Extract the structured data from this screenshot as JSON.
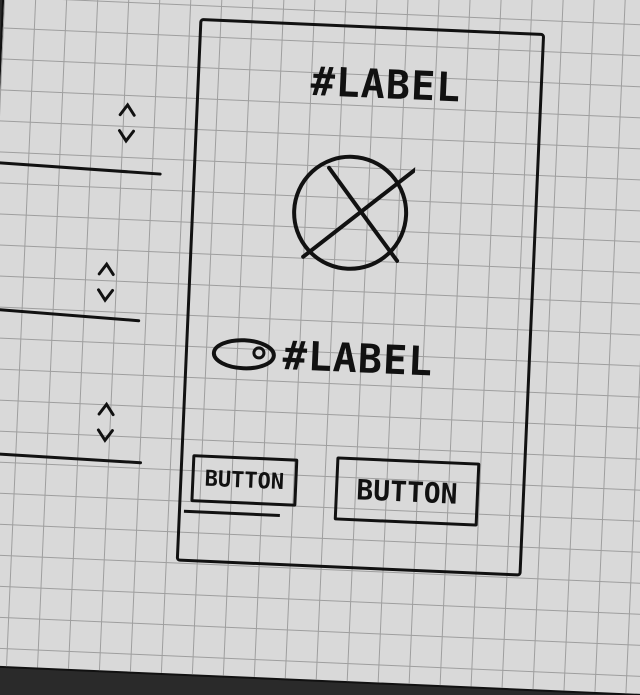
{
  "screen": {
    "title_label": "#LABEL",
    "radio_label": "#LABEL"
  },
  "picker": {
    "rows": 3,
    "stepper_icon": "up-down-chevron-icon"
  },
  "image": {
    "icon": "image-placeholder-icon"
  },
  "buttons": {
    "left_label": "BUTTON",
    "right_label": "BUTTON"
  }
}
